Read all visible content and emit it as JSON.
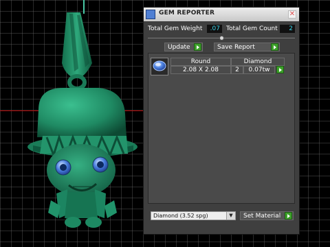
{
  "panel": {
    "title": "GEM REPORTER",
    "close_glyph": "✕",
    "total_gem_weight_label": "Total Gem Weight",
    "total_gem_weight_value": ".07",
    "total_gem_count_label": "Total Gem Count",
    "total_gem_count_value": "2",
    "update_label": "Update",
    "save_report_label": "Save Report",
    "table": {
      "shape_header": "Round",
      "material_header": "Diamond",
      "size": "2.08 X 2.08",
      "count": "2",
      "weight": "0.07tw"
    },
    "material_select": "Diamond     (3.52 spg)",
    "set_material_label": "Set Material"
  },
  "colors": {
    "model_green": "#1f8a63",
    "value_cyan": "#3bd3e8",
    "go_green": "#3da02a",
    "gem_blue": "#4a7fe0"
  }
}
